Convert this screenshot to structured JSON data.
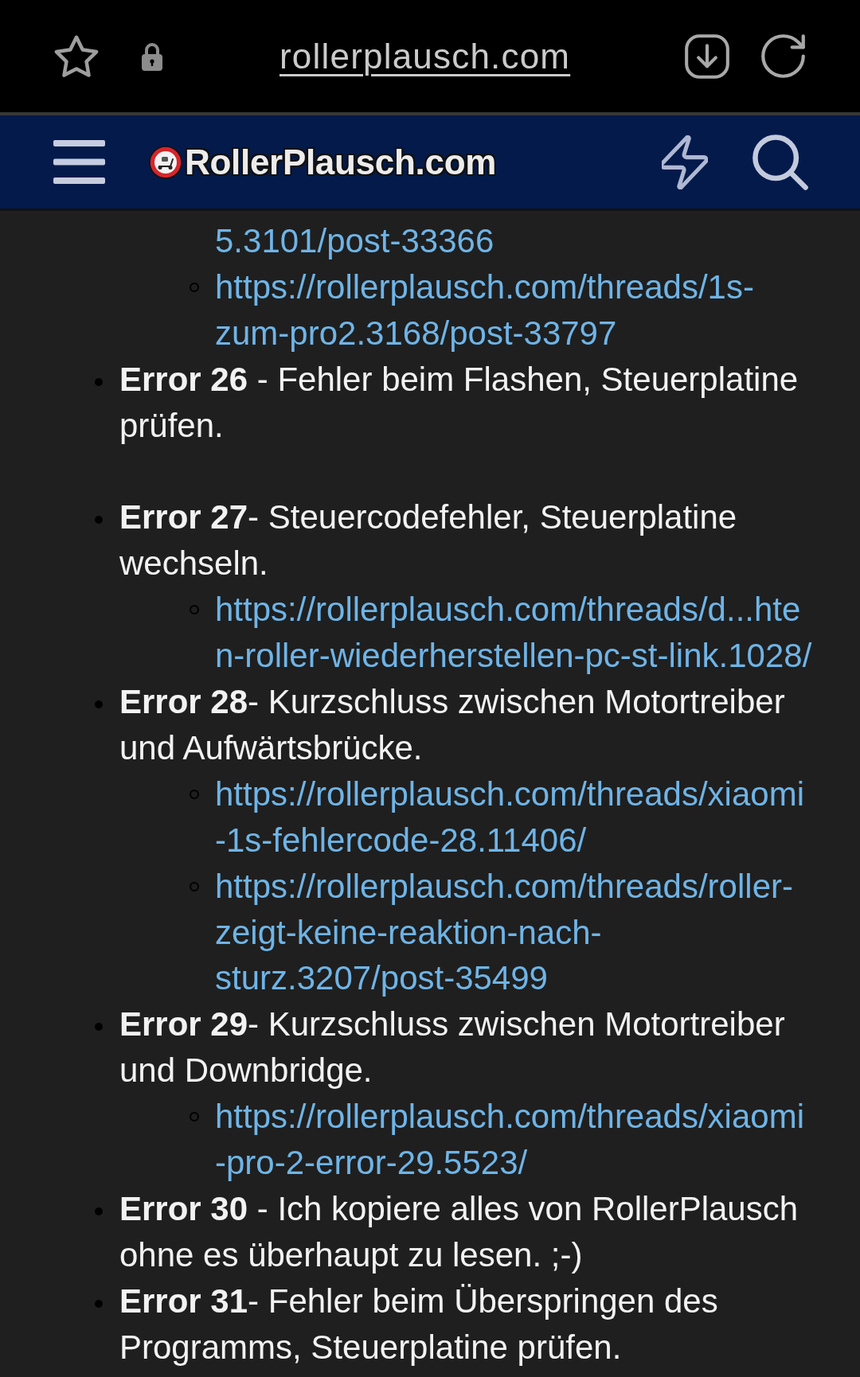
{
  "browser_bar": {
    "url": "rollerplausch.com"
  },
  "site_header": {
    "logo_text": "RollerPlausch.com"
  },
  "items": [
    {
      "kind": "link_continuation",
      "text": "5.3101/post-33366",
      "links": [
        "https://rollerplausch.com/threads/1s-zum-pro2.3168/post-33797"
      ]
    },
    {
      "kind": "error",
      "text": "**Error 26** - Fehler beim Flashen, Steuerplatine prüfen."
    },
    {
      "kind": "blank_line"
    },
    {
      "kind": "error",
      "text": "**Error 27**- Steuercodefehler, Steuerplatine wechseln.",
      "links": [
        "https://rollerplausch.com/threads/d...hten-roller-wiederherstellen-pc-st-link.1028/"
      ]
    },
    {
      "kind": "error",
      "text": "**Error 28**- Kurzschluss zwischen Motortreiber und Aufwärtsbrücke.",
      "links": [
        "https://rollerplausch.com/threads/xiaomi-1s-fehlercode-28.11406/",
        "https://rollerplausch.com/threads/roller-zeigt-keine-reaktion-nach-sturz.3207/post-35499"
      ]
    },
    {
      "kind": "error",
      "text": "**Error 29**- Kurzschluss zwischen Motortreiber und Downbridge.",
      "links": [
        "https://rollerplausch.com/threads/xiaomi-pro-2-error-29.5523/"
      ]
    },
    {
      "kind": "error",
      "text": "**Error 30** - Ich kopiere alles von RollerPlausch ohne es überhaupt zu lesen. ;-)"
    },
    {
      "kind": "error",
      "text": "**Error 31**- Fehler beim Überspringen des Programms, Steuerplatine prüfen."
    }
  ]
}
